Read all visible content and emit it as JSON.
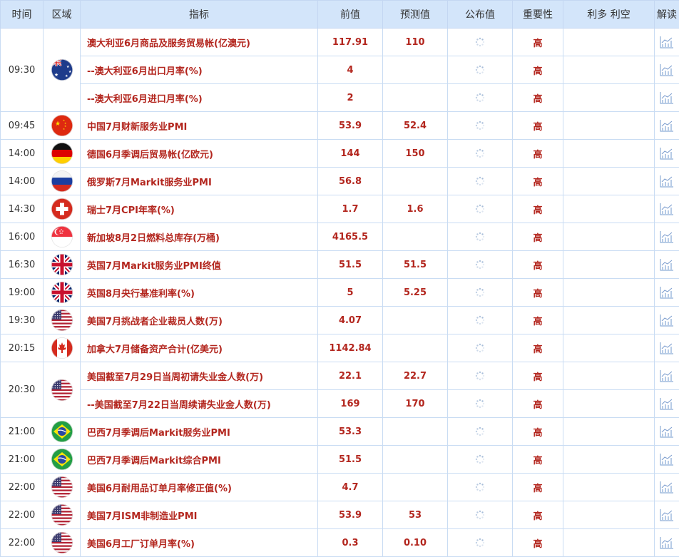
{
  "header": {
    "time": "时间",
    "region": "区域",
    "indicator": "指标",
    "previous": "前值",
    "forecast": "预测值",
    "actual": "公布值",
    "importance": "重要性",
    "impact": "利多 利空",
    "interpret": "解读"
  },
  "rows": [
    {
      "time": "09:30",
      "flag": "au",
      "indicator": "澳大利亚6月商品及服务贸易帐(亿澳元)",
      "previous": "117.91",
      "forecast": "110",
      "importance": "高"
    },
    {
      "time": "",
      "flag": "",
      "indicator": "--澳大利亚6月出口月率(%)",
      "previous": "4",
      "forecast": "",
      "importance": "高"
    },
    {
      "time": "",
      "flag": "",
      "indicator": "--澳大利亚6月进口月率(%)",
      "previous": "2",
      "forecast": "",
      "importance": "高"
    },
    {
      "time": "09:45",
      "flag": "cn",
      "indicator": "中国7月财新服务业PMI",
      "previous": "53.9",
      "forecast": "52.4",
      "importance": "高"
    },
    {
      "time": "14:00",
      "flag": "de",
      "indicator": "德国6月季调后贸易帐(亿欧元)",
      "previous": "144",
      "forecast": "150",
      "importance": "高"
    },
    {
      "time": "14:00",
      "flag": "ru",
      "indicator": "俄罗斯7月Markit服务业PMI",
      "previous": "56.8",
      "forecast": "",
      "importance": "高"
    },
    {
      "time": "14:30",
      "flag": "ch",
      "indicator": "瑞士7月CPI年率(%)",
      "previous": "1.7",
      "forecast": "1.6",
      "importance": "高"
    },
    {
      "time": "16:00",
      "flag": "sg",
      "indicator": "新加坡8月2日燃料总库存(万桶)",
      "previous": "4165.5",
      "forecast": "",
      "importance": "高"
    },
    {
      "time": "16:30",
      "flag": "gb",
      "indicator": "英国7月Markit服务业PMI终值",
      "previous": "51.5",
      "forecast": "51.5",
      "importance": "高"
    },
    {
      "time": "19:00",
      "flag": "gb",
      "indicator": "英国8月央行基准利率(%)",
      "previous": "5",
      "forecast": "5.25",
      "importance": "高"
    },
    {
      "time": "19:30",
      "flag": "us",
      "indicator": "美国7月挑战者企业裁员人数(万)",
      "previous": "4.07",
      "forecast": "",
      "importance": "高"
    },
    {
      "time": "20:15",
      "flag": "ca",
      "indicator": "加拿大7月储备资产合计(亿美元)",
      "previous": "1142.84",
      "forecast": "",
      "importance": "高"
    },
    {
      "time": "20:30",
      "flag": "us",
      "indicator": "美国截至7月29日当周初请失业金人数(万)",
      "previous": "22.1",
      "forecast": "22.7",
      "importance": "高"
    },
    {
      "time": "",
      "flag": "",
      "indicator": "--美国截至7月22日当周续请失业金人数(万)",
      "previous": "169",
      "forecast": "170",
      "importance": "高"
    },
    {
      "time": "21:00",
      "flag": "br",
      "indicator": "巴西7月季调后Markit服务业PMI",
      "previous": "53.3",
      "forecast": "",
      "importance": "高"
    },
    {
      "time": "21:00",
      "flag": "br",
      "indicator": "巴西7月季调后Markit综合PMI",
      "previous": "51.5",
      "forecast": "",
      "importance": "高"
    },
    {
      "time": "22:00",
      "flag": "us",
      "indicator": "美国6月耐用品订单月率修正值(%)",
      "previous": "4.7",
      "forecast": "",
      "importance": "高"
    },
    {
      "time": "22:00",
      "flag": "us",
      "indicator": "美国7月ISM非制造业PMI",
      "previous": "53.9",
      "forecast": "53",
      "importance": "高"
    },
    {
      "time": "22:00",
      "flag": "us",
      "indicator": "美国6月工厂订单月率(%)",
      "previous": "0.3",
      "forecast": "0.10",
      "importance": "高"
    }
  ],
  "groups": [
    [
      0,
      3
    ],
    [
      12,
      2
    ]
  ],
  "colors": {
    "header_bg": "#d3e5fa",
    "value_red": "#b3261e",
    "border": "#c9dcf3"
  },
  "icons": {
    "actual_cell": "loading-spinner-icon",
    "interpret_cell": "chart-icon"
  }
}
